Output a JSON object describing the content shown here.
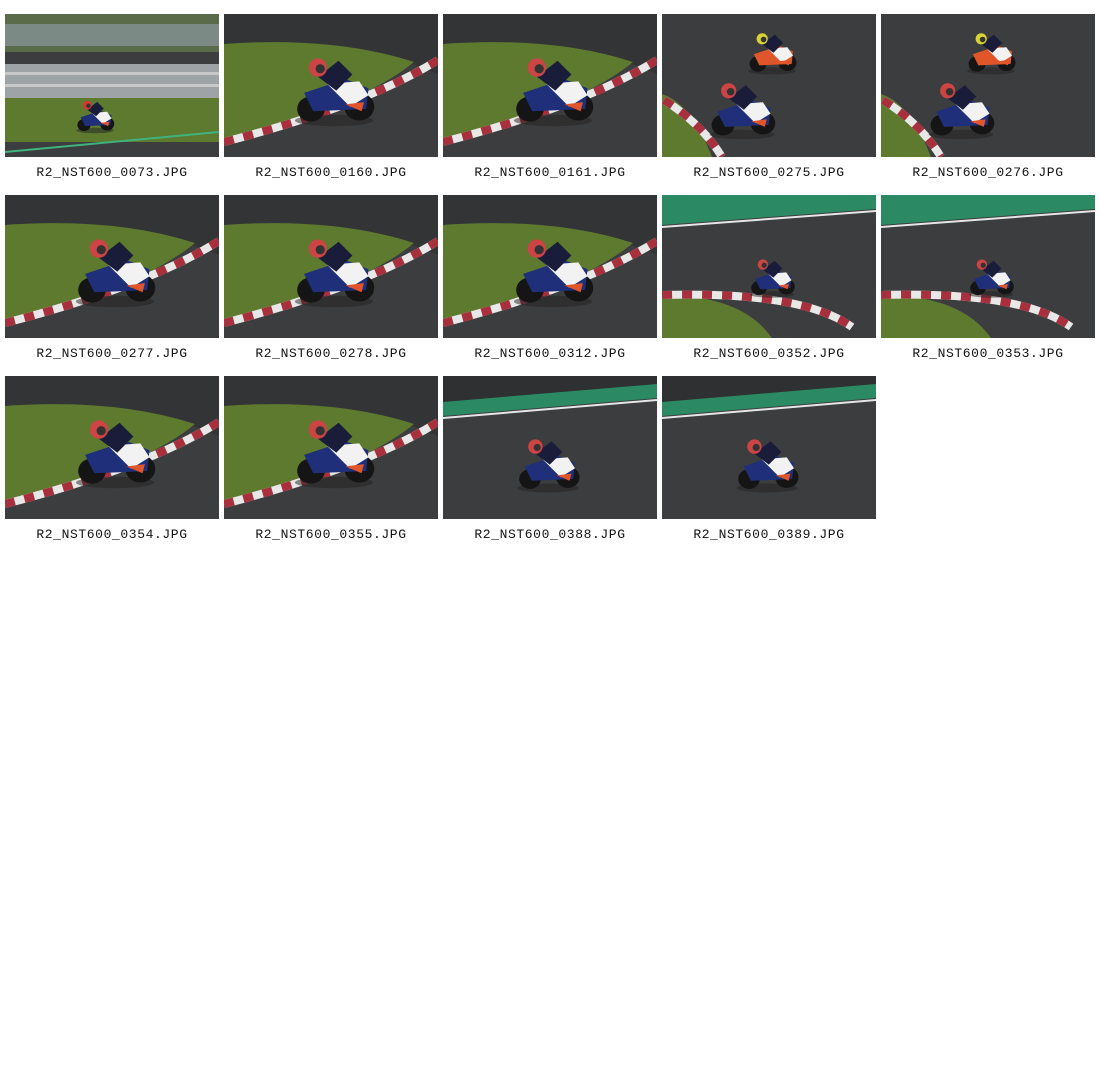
{
  "gallery": {
    "photos": [
      {
        "filename": "R2_NST600_0073.JPG",
        "scene": "wide"
      },
      {
        "filename": "R2_NST600_0160.JPG",
        "scene": "lean"
      },
      {
        "filename": "R2_NST600_0161.JPG",
        "scene": "lean"
      },
      {
        "filename": "R2_NST600_0275.JPG",
        "scene": "two-riders"
      },
      {
        "filename": "R2_NST600_0276.JPG",
        "scene": "two-riders"
      },
      {
        "filename": "R2_NST600_0277.JPG",
        "scene": "lean"
      },
      {
        "filename": "R2_NST600_0278.JPG",
        "scene": "lean"
      },
      {
        "filename": "R2_NST600_0312.JPG",
        "scene": "lean"
      },
      {
        "filename": "R2_NST600_0352.JPG",
        "scene": "green-track"
      },
      {
        "filename": "R2_NST600_0353.JPG",
        "scene": "green-track"
      },
      {
        "filename": "R2_NST600_0354.JPG",
        "scene": "lean"
      },
      {
        "filename": "R2_NST600_0355.JPG",
        "scene": "lean"
      },
      {
        "filename": "R2_NST600_0388.JPG",
        "scene": "approach"
      },
      {
        "filename": "R2_NST600_0389.JPG",
        "scene": "approach"
      }
    ],
    "colors": {
      "asphalt": "#3c3d3f",
      "grass": "#5d7a2e",
      "kerb_red": "#a8303c",
      "kerb_white": "#e8e8e8",
      "green_strip": "#2b8a63",
      "bike_blue": "#1f2f7a",
      "bike_white": "#f2f2f2",
      "accent_orange": "#e0562a"
    }
  }
}
